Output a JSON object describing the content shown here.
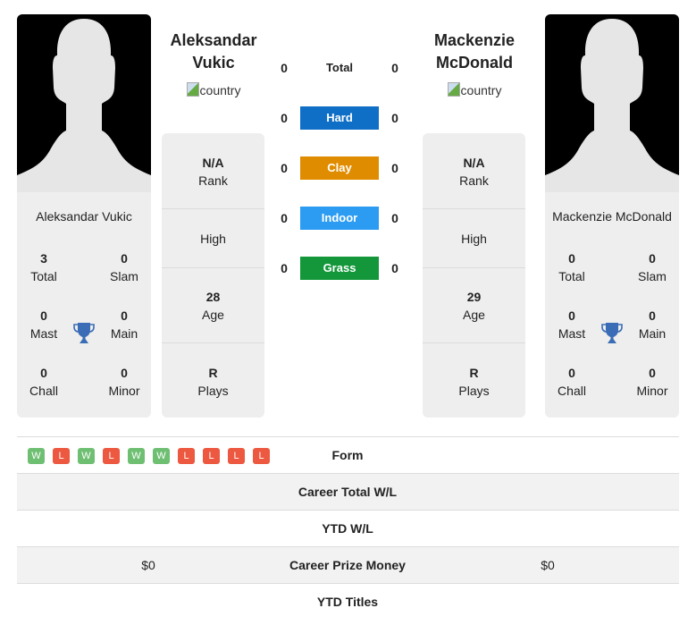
{
  "players": [
    {
      "header_name": "Aleksandar Vukic",
      "card_name": "Aleksandar Vukic",
      "country_alt": "country",
      "titles": {
        "total": {
          "value": "3",
          "label": "Total"
        },
        "slam": {
          "value": "0",
          "label": "Slam"
        },
        "mast": {
          "value": "0",
          "label": "Mast"
        },
        "main": {
          "value": "0",
          "label": "Main"
        },
        "chall": {
          "value": "0",
          "label": "Chall"
        },
        "minor": {
          "value": "0",
          "label": "Minor"
        }
      },
      "info": {
        "rank": {
          "value": "N/A",
          "label": "Rank"
        },
        "high": {
          "label": "High"
        },
        "age": {
          "value": "28",
          "label": "Age"
        },
        "plays": {
          "value": "R",
          "label": "Plays"
        }
      }
    },
    {
      "header_name": "Mackenzie McDonald",
      "card_name": "Mackenzie McDonald",
      "country_alt": "country",
      "titles": {
        "total": {
          "value": "0",
          "label": "Total"
        },
        "slam": {
          "value": "0",
          "label": "Slam"
        },
        "mast": {
          "value": "0",
          "label": "Mast"
        },
        "main": {
          "value": "0",
          "label": "Main"
        },
        "chall": {
          "value": "0",
          "label": "Chall"
        },
        "minor": {
          "value": "0",
          "label": "Minor"
        }
      },
      "info": {
        "rank": {
          "value": "N/A",
          "label": "Rank"
        },
        "high": {
          "label": "High"
        },
        "age": {
          "value": "29",
          "label": "Age"
        },
        "plays": {
          "value": "R",
          "label": "Plays"
        }
      }
    }
  ],
  "h2h": [
    {
      "label": "Total",
      "left": "0",
      "right": "0",
      "color": null
    },
    {
      "label": "Hard",
      "left": "0",
      "right": "0",
      "color": "#0f6fc6"
    },
    {
      "label": "Clay",
      "left": "0",
      "right": "0",
      "color": "#e08c00"
    },
    {
      "label": "Indoor",
      "left": "0",
      "right": "0",
      "color": "#2b9cf2"
    },
    {
      "label": "Grass",
      "left": "0",
      "right": "0",
      "color": "#13973a"
    }
  ],
  "form": {
    "label": "Form",
    "results": [
      "W",
      "L",
      "W",
      "L",
      "W",
      "W",
      "L",
      "L",
      "L",
      "L"
    ],
    "colors": {
      "W": "#6fbf73",
      "L": "#ec5840"
    }
  },
  "comparison": [
    {
      "label": "Career Total W/L",
      "left": "",
      "right": ""
    },
    {
      "label": "YTD W/L",
      "left": "",
      "right": ""
    },
    {
      "label": "Career Prize Money",
      "left": "$0",
      "right": "$0"
    },
    {
      "label": "YTD Titles",
      "left": "",
      "right": ""
    }
  ],
  "colors": {
    "card_bg": "#eeeeee",
    "trophy": "#3a6db5"
  }
}
